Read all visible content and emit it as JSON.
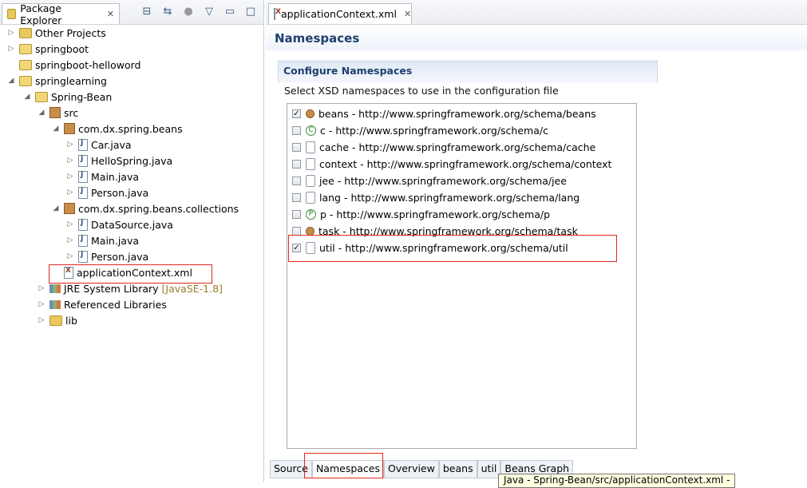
{
  "explorer": {
    "title": "Package Explorer",
    "tree": [
      {
        "label": "Other Projects",
        "decor": ""
      },
      {
        "label": "springboot",
        "decor": ""
      },
      {
        "label": "springboot-helloword",
        "decor": ""
      },
      {
        "label": "springlearning",
        "decor": ""
      },
      {
        "label": "Spring-Bean",
        "decor": ""
      },
      {
        "label": "src",
        "decor": ""
      },
      {
        "label": "com.dx.spring.beans",
        "decor": ""
      },
      {
        "label": "Car.java",
        "decor": ""
      },
      {
        "label": "HelloSpring.java",
        "decor": ""
      },
      {
        "label": "Main.java",
        "decor": ""
      },
      {
        "label": "Person.java",
        "decor": ""
      },
      {
        "label": "com.dx.spring.beans.collections",
        "decor": ""
      },
      {
        "label": "DataSource.java",
        "decor": ""
      },
      {
        "label": "Main.java",
        "decor": ""
      },
      {
        "label": "Person.java",
        "decor": ""
      },
      {
        "label": "applicationContext.xml",
        "decor": ""
      },
      {
        "label": "JRE System Library",
        "decor": "[JavaSE-1.8]"
      },
      {
        "label": "Referenced Libraries",
        "decor": ""
      },
      {
        "label": "lib",
        "decor": ""
      }
    ]
  },
  "editor": {
    "tab_title": "applicationContext.xml",
    "header": "Namespaces",
    "section_title": "Configure Namespaces",
    "section_desc": "Select XSD namespaces to use in the configuration file",
    "namespaces": [
      {
        "label": "beans - http://www.springframework.org/schema/beans",
        "checked": true
      },
      {
        "label": "c - http://www.springframework.org/schema/c",
        "checked": false
      },
      {
        "label": "cache - http://www.springframework.org/schema/cache",
        "checked": false
      },
      {
        "label": "context - http://www.springframework.org/schema/context",
        "checked": false
      },
      {
        "label": "jee - http://www.springframework.org/schema/jee",
        "checked": false
      },
      {
        "label": "lang - http://www.springframework.org/schema/lang",
        "checked": false
      },
      {
        "label": "p - http://www.springframework.org/schema/p",
        "checked": false
      },
      {
        "label": "task - http://www.springframework.org/schema/task",
        "checked": false
      },
      {
        "label": "util - http://www.springframework.org/schema/util",
        "checked": true
      }
    ],
    "page_tabs": [
      "Source",
      "Namespaces",
      "Overview",
      "beans",
      "util",
      "Beans Graph"
    ],
    "tooltip": "Java - Spring-Bean/src/applicationContext.xml -"
  },
  "icons": {
    "close": "close-icon",
    "collapse": "collapse-all-icon",
    "link": "link-with-editor-icon",
    "menu": "view-menu-icon",
    "minimize": "minimize-icon",
    "maximize": "maximize-icon"
  }
}
